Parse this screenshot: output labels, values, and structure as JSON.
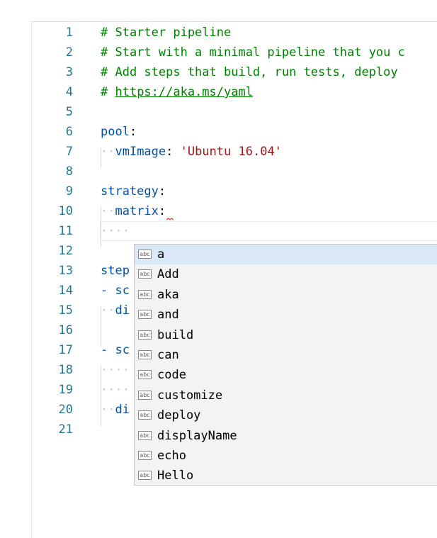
{
  "editor": {
    "lines": [
      {
        "n": "1",
        "text": "# Starter pipeline"
      },
      {
        "n": "2",
        "text": "# Start with a minimal pipeline that you c"
      },
      {
        "n": "3",
        "text": "# Add steps that build, run tests, deploy"
      },
      {
        "n": "4",
        "hash": "# ",
        "link": "https://aka.ms/yaml"
      },
      {
        "n": "5"
      },
      {
        "n": "6",
        "key": "pool",
        "colon": ":"
      },
      {
        "n": "7",
        "key": "vmImage",
        "colon": ": ",
        "str": "'Ubuntu 16.04'"
      },
      {
        "n": "8"
      },
      {
        "n": "9",
        "key": "strategy",
        "colon": ":"
      },
      {
        "n": "10",
        "key": "matrix",
        "colon": ":"
      },
      {
        "n": "11"
      },
      {
        "n": "12"
      },
      {
        "n": "13",
        "key": "step"
      },
      {
        "n": "14",
        "text": "- sc"
      },
      {
        "n": "15",
        "key": "di"
      },
      {
        "n": "16"
      },
      {
        "n": "17",
        "text": "- sc"
      },
      {
        "n": "18"
      },
      {
        "n": "19"
      },
      {
        "n": "20",
        "key": "di"
      },
      {
        "n": "21"
      }
    ]
  },
  "suggestions": {
    "icon_label": "abc",
    "items": [
      "a",
      "Add",
      "aka",
      "and",
      "build",
      "can",
      "code",
      "customize",
      "deploy",
      "displayName",
      "echo",
      "Hello"
    ],
    "selected": "a"
  },
  "colors": {
    "line_number": "#237893",
    "comment": "#008000",
    "key": "#0451a5",
    "string": "#a31515",
    "selected_suggestion": "#dbe8f8"
  }
}
